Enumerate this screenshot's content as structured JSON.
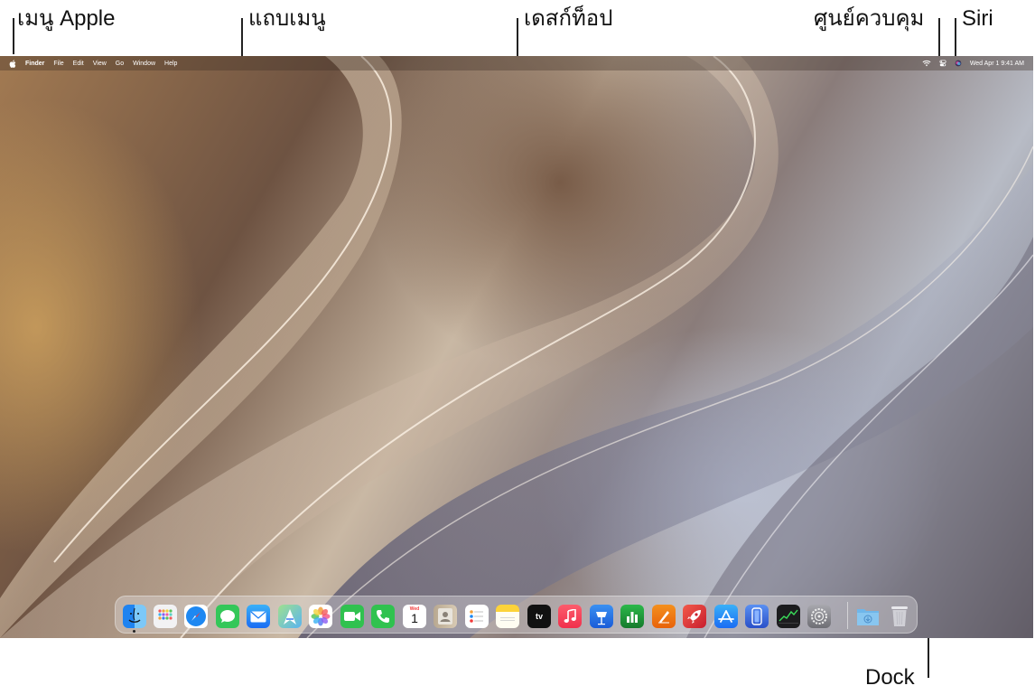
{
  "callouts": {
    "apple_menu": "เมนู Apple",
    "menu_bar": "แถบเมนู",
    "desktop": "เดสก์ท็อป",
    "control_center": "ศูนย์ควบคุม",
    "siri": "Siri",
    "dock": "Dock"
  },
  "menubar": {
    "app_name": "Finder",
    "menus": [
      "File",
      "Edit",
      "View",
      "Go",
      "Window",
      "Help"
    ],
    "date_time": "Wed Apr 1  9:41 AM",
    "status_icons": [
      "wifi-icon",
      "control-center-icon",
      "siri-icon"
    ]
  },
  "dock": {
    "apps": [
      {
        "icon": "finder-icon",
        "color": "#2e8ff0"
      },
      {
        "icon": "launchpad-icon",
        "color": "#f2f2f4"
      },
      {
        "icon": "safari-icon",
        "color": "#1e88f2"
      },
      {
        "icon": "messages-icon",
        "color": "#34c759"
      },
      {
        "icon": "mail-icon",
        "color": "#1a7cf3"
      },
      {
        "icon": "maps-icon",
        "color": "#6cc06a"
      },
      {
        "icon": "photos-icon",
        "color": "#ffffff"
      },
      {
        "icon": "facetime-icon",
        "color": "#30c24f"
      },
      {
        "icon": "phone-icon",
        "color": "#30c24f"
      },
      {
        "icon": "calendar-icon",
        "color": "#ffffff",
        "day": "Wed",
        "date": "1"
      },
      {
        "icon": "contacts-icon",
        "color": "#c8b59c"
      },
      {
        "icon": "reminders-icon",
        "color": "#ffffff"
      },
      {
        "icon": "notes-icon",
        "color": "#fcd33a"
      },
      {
        "icon": "apple-tv-icon",
        "color": "#111111",
        "label": "tv"
      },
      {
        "icon": "music-icon",
        "color": "#fa3c54"
      },
      {
        "icon": "keynote-icon",
        "color": "#1f74e6"
      },
      {
        "icon": "numbers-icon",
        "color": "#1f9c3a"
      },
      {
        "icon": "pages-icon",
        "color": "#f0780f"
      },
      {
        "icon": "rocket-icon",
        "color": "#e63838"
      },
      {
        "icon": "app-store-icon",
        "color": "#1c8cf5"
      },
      {
        "icon": "iphone-mirroring-icon",
        "color": "#3a6fe0"
      },
      {
        "icon": "stocks-icon",
        "color": "#1c1c1e"
      },
      {
        "icon": "system-settings-icon",
        "color": "#8e8e93"
      }
    ],
    "extras": [
      {
        "icon": "downloads-folder-icon",
        "color": "#6fb6ea"
      },
      {
        "icon": "trash-icon",
        "color": "#d8d8dc"
      }
    ]
  }
}
